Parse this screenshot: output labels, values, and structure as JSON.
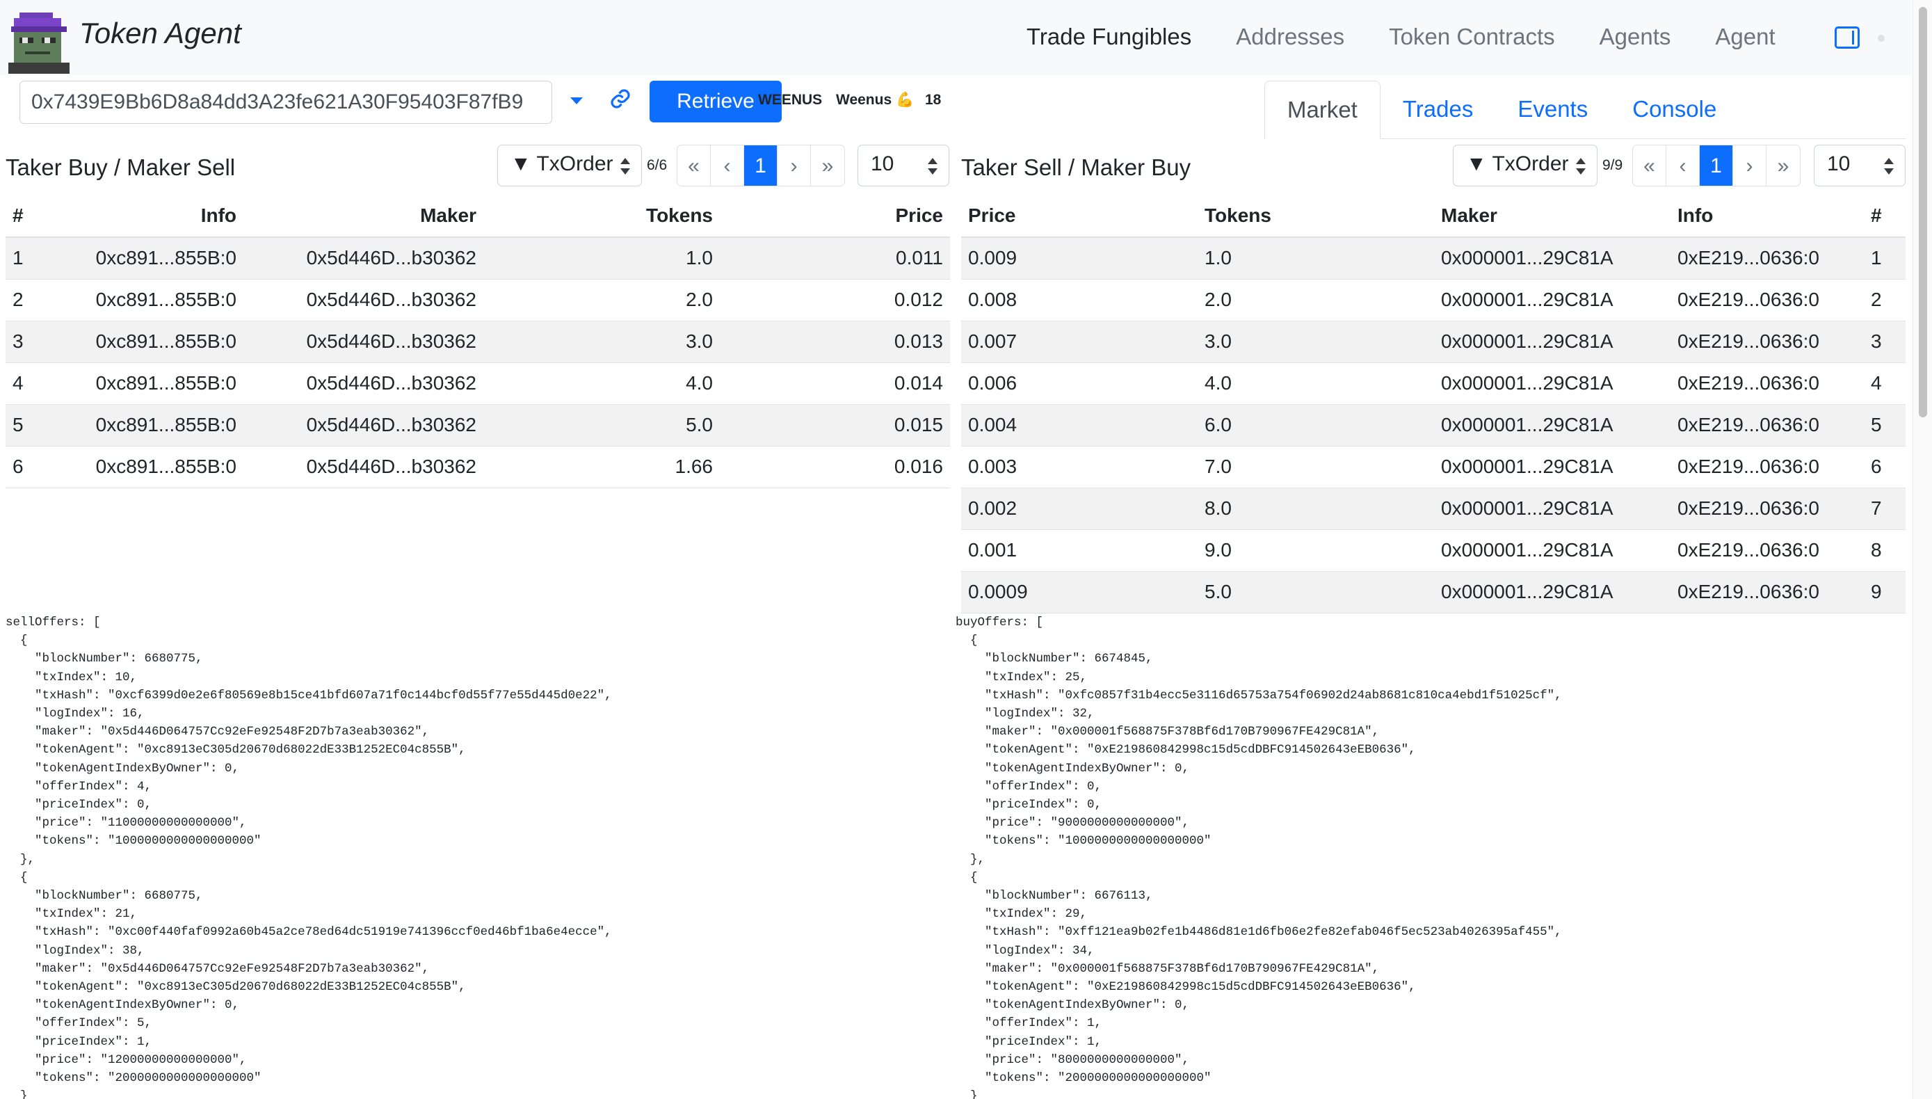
{
  "app": {
    "title": "Token Agent"
  },
  "nav": [
    {
      "label": "Trade Fungibles",
      "active": true
    },
    {
      "label": "Addresses",
      "active": false
    },
    {
      "label": "Token Contracts",
      "active": false
    },
    {
      "label": "Agents",
      "active": false
    },
    {
      "label": "Agent",
      "active": false
    }
  ],
  "toolbar": {
    "address_value": "0x7439E9Bb6D8a84dd3A23fe621A30F95403F87fB9",
    "retrieve_label": "Retrieve",
    "token_symbol": "WEENUS",
    "token_name": "Weenus 💪",
    "decimals": "18"
  },
  "tabs": [
    {
      "label": "Market",
      "active": true
    },
    {
      "label": "Trades",
      "active": false
    },
    {
      "label": "Events",
      "active": false
    },
    {
      "label": "Console",
      "active": false
    }
  ],
  "sell_side": {
    "title": "Taker Buy / Maker Sell",
    "sort": "▼ TxOrder",
    "count": "6/6",
    "pager": [
      "«",
      "‹",
      "1",
      "›",
      "»"
    ],
    "page_size": "10",
    "columns": [
      "#",
      "Info",
      "Maker",
      "Tokens",
      "Price"
    ],
    "rows": [
      [
        "1",
        "0xc891...855B:0",
        "0x5d446D...b30362",
        "1.0",
        "0.011"
      ],
      [
        "2",
        "0xc891...855B:0",
        "0x5d446D...b30362",
        "2.0",
        "0.012"
      ],
      [
        "3",
        "0xc891...855B:0",
        "0x5d446D...b30362",
        "3.0",
        "0.013"
      ],
      [
        "4",
        "0xc891...855B:0",
        "0x5d446D...b30362",
        "4.0",
        "0.014"
      ],
      [
        "5",
        "0xc891...855B:0",
        "0x5d446D...b30362",
        "5.0",
        "0.015"
      ],
      [
        "6",
        "0xc891...855B:0",
        "0x5d446D...b30362",
        "1.66",
        "0.016"
      ]
    ],
    "json_dump": "sellOffers: [\n  {\n    \"blockNumber\": 6680775,\n    \"txIndex\": 10,\n    \"txHash\": \"0xcf6399d0e2e6f80569e8b15ce41bfd607a71f0c144bcf0d55f77e55d445d0e22\",\n    \"logIndex\": 16,\n    \"maker\": \"0x5d446D064757Cc92eFe92548F2D7b7a3eab30362\",\n    \"tokenAgent\": \"0xc8913eC305d20670d68022dE33B1252EC04c855B\",\n    \"tokenAgentIndexByOwner\": 0,\n    \"offerIndex\": 4,\n    \"priceIndex\": 0,\n    \"price\": \"11000000000000000\",\n    \"tokens\": \"1000000000000000000\"\n  },\n  {\n    \"blockNumber\": 6680775,\n    \"txIndex\": 21,\n    \"txHash\": \"0xc00f440faf0992a60b45a2ce78ed64dc51919e741396ccf0ed46bf1ba6e4ecce\",\n    \"logIndex\": 38,\n    \"maker\": \"0x5d446D064757Cc92eFe92548F2D7b7a3eab30362\",\n    \"tokenAgent\": \"0xc8913eC305d20670d68022dE33B1252EC04c855B\",\n    \"tokenAgentIndexByOwner\": 0,\n    \"offerIndex\": 5,\n    \"priceIndex\": 1,\n    \"price\": \"12000000000000000\",\n    \"tokens\": \"2000000000000000000\"\n  }"
  },
  "buy_side": {
    "title": "Taker Sell / Maker Buy",
    "sort": "▼ TxOrder",
    "count": "9/9",
    "pager": [
      "«",
      "‹",
      "1",
      "›",
      "»"
    ],
    "page_size": "10",
    "columns": [
      "Price",
      "Tokens",
      "Maker",
      "Info",
      "#"
    ],
    "rows": [
      [
        "0.009",
        "1.0",
        "0x000001...29C81A",
        "0xE219...0636:0",
        "1"
      ],
      [
        "0.008",
        "2.0",
        "0x000001...29C81A",
        "0xE219...0636:0",
        "2"
      ],
      [
        "0.007",
        "3.0",
        "0x000001...29C81A",
        "0xE219...0636:0",
        "3"
      ],
      [
        "0.006",
        "4.0",
        "0x000001...29C81A",
        "0xE219...0636:0",
        "4"
      ],
      [
        "0.004",
        "6.0",
        "0x000001...29C81A",
        "0xE219...0636:0",
        "5"
      ],
      [
        "0.003",
        "7.0",
        "0x000001...29C81A",
        "0xE219...0636:0",
        "6"
      ],
      [
        "0.002",
        "8.0",
        "0x000001...29C81A",
        "0xE219...0636:0",
        "7"
      ],
      [
        "0.001",
        "9.0",
        "0x000001...29C81A",
        "0xE219...0636:0",
        "8"
      ],
      [
        "0.0009",
        "5.0",
        "0x000001...29C81A",
        "0xE219...0636:0",
        "9"
      ]
    ],
    "json_dump": "buyOffers: [\n  {\n    \"blockNumber\": 6674845,\n    \"txIndex\": 25,\n    \"txHash\": \"0xfc0857f31b4ecc5e3116d65753a754f06902d24ab8681c810ca4ebd1f51025cf\",\n    \"logIndex\": 32,\n    \"maker\": \"0x000001f568875F378Bf6d170B790967FE429C81A\",\n    \"tokenAgent\": \"0xE219860842998c15d5cdDBFC914502643eEB0636\",\n    \"tokenAgentIndexByOwner\": 0,\n    \"offerIndex\": 0,\n    \"priceIndex\": 0,\n    \"price\": \"9000000000000000\",\n    \"tokens\": \"1000000000000000000\"\n  },\n  {\n    \"blockNumber\": 6676113,\n    \"txIndex\": 29,\n    \"txHash\": \"0xff121ea9b02fe1b4486d81e1d6fb06e2fe82efab046f5ec523ab4026395af455\",\n    \"logIndex\": 34,\n    \"maker\": \"0x000001f568875F378Bf6d170B790967FE429C81A\",\n    \"tokenAgent\": \"0xE219860842998c15d5cdDBFC914502643eEB0636\",\n    \"tokenAgentIndexByOwner\": 0,\n    \"offerIndex\": 1,\n    \"priceIndex\": 1,\n    \"price\": \"8000000000000000\",\n    \"tokens\": \"2000000000000000000\"\n  }"
  }
}
